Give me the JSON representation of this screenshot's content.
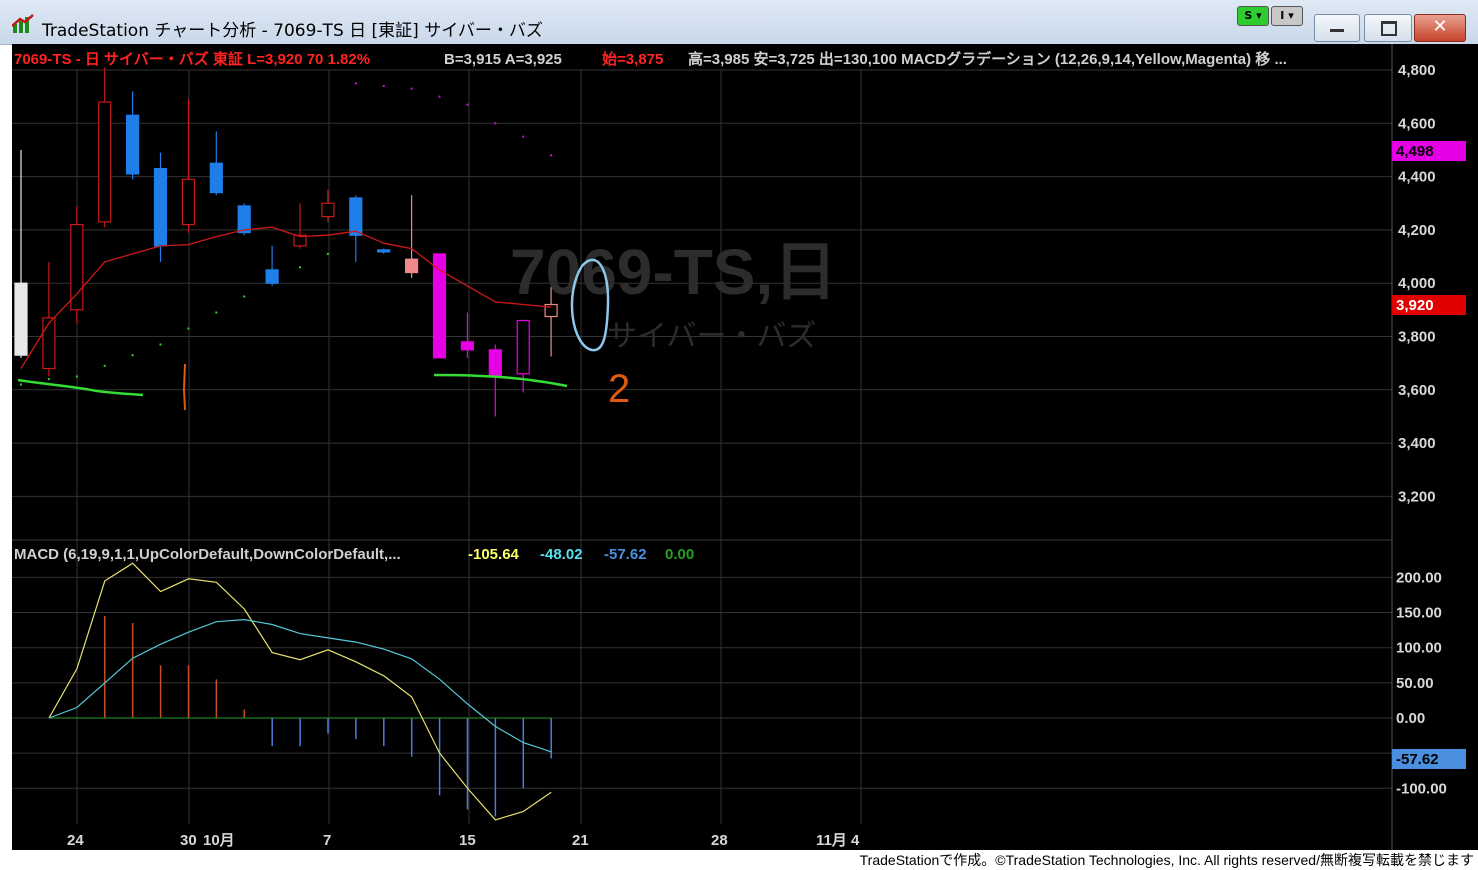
{
  "window": {
    "title": "TradeStation チャート分析 - 7069-TS 日 [東証] サイバー・バズ",
    "mini_buttons": [
      "S",
      "I"
    ],
    "controls": [
      "minimize",
      "maximize",
      "close"
    ]
  },
  "status_line": {
    "symbol_part": "7069-TS - 日  サイバー・バズ  東証  L=3,920  70  1.82%",
    "quote_part": "B=3,915  A=3,925",
    "open_part": "始=3,875",
    "rest_part": "高=3,985  安=3,725  出=130,100  MACDグラデーション (12,26,9,14,Yellow,Magenta)  移 ..."
  },
  "watermark": {
    "symbol": "7069-TS,日",
    "name": "サイバー・バズ"
  },
  "annotation": {
    "number": "2"
  },
  "price_axis": {
    "ticks": [
      "4,800",
      "4,600",
      "4,400",
      "4,200",
      "4,000",
      "3,800",
      "3,600",
      "3,400",
      "3,200"
    ],
    "badge_magenta": "4,498",
    "badge_red": "3,920",
    "colors": {
      "magenta": "#e600e6",
      "red": "#e00000"
    }
  },
  "macd_panel": {
    "label": "MACD (6,19,9,1,1,UpColorDefault,DownColorDefault,...",
    "value_yellow": "-105.64",
    "value_cyan": "-48.02",
    "value_blue": "-57.62",
    "value_green": "0.00",
    "ticks": [
      "200.00",
      "150.00",
      "100.00",
      "50.00",
      "0.00",
      "-100.00"
    ],
    "badge_blue": "-57.62",
    "colors": {
      "yellow": "#ffff66",
      "cyan": "#55e0f0",
      "blue": "#4a8fe0",
      "green": "#22a022"
    }
  },
  "date_axis": {
    "labels": [
      "24",
      "30",
      "10月",
      "7",
      "15",
      "21",
      "28",
      "11月 4"
    ]
  },
  "footer": {
    "text": "TradeStationで作成。©TradeStation Technologies, Inc. All rights reserved/無断複写転載を禁じます"
  },
  "chart_data": {
    "type": "candlestick",
    "price_ylim": [
      3100,
      4850
    ],
    "candles": [
      {
        "o": 3730,
        "h": 4500,
        "l": 3720,
        "c": 4000,
        "color": "white"
      },
      {
        "o": 3680,
        "h": 4080,
        "l": 3650,
        "c": 3870,
        "color": "red"
      },
      {
        "o": 3900,
        "h": 4290,
        "l": 3850,
        "c": 4220,
        "color": "red"
      },
      {
        "o": 4230,
        "h": 4810,
        "l": 4210,
        "c": 4680,
        "color": "red"
      },
      {
        "o": 4630,
        "h": 4720,
        "l": 4390,
        "c": 4410,
        "color": "blue"
      },
      {
        "o": 4430,
        "h": 4490,
        "l": 4080,
        "c": 4140,
        "color": "blue"
      },
      {
        "o": 4220,
        "h": 4690,
        "l": 4190,
        "c": 4390,
        "color": "red"
      },
      {
        "o": 4450,
        "h": 4570,
        "l": 4330,
        "c": 4340,
        "color": "blue"
      },
      {
        "o": 4290,
        "h": 4300,
        "l": 4180,
        "c": 4190,
        "color": "blue"
      },
      {
        "o": 4050,
        "h": 4140,
        "l": 3990,
        "c": 4000,
        "color": "blue"
      },
      {
        "o": 4140,
        "h": 4300,
        "l": 4130,
        "c": 4180,
        "color": "red"
      },
      {
        "o": 4250,
        "h": 4350,
        "l": 4230,
        "c": 4300,
        "color": "red"
      },
      {
        "o": 4320,
        "h": 4330,
        "l": 4080,
        "c": 4180,
        "color": "blue"
      },
      {
        "o": 4125,
        "h": 4130,
        "l": 4110,
        "c": 4120,
        "color": "blue"
      },
      {
        "o": 4040,
        "h": 4330,
        "l": 4020,
        "c": 4090,
        "color": "salmon"
      },
      {
        "o": 4110,
        "h": 4110,
        "l": 3720,
        "c": 3720,
        "color": "magenta"
      },
      {
        "o": 3780,
        "h": 3890,
        "l": 3720,
        "c": 3750,
        "color": "magenta"
      },
      {
        "o": 3750,
        "h": 3770,
        "l": 3500,
        "c": 3650,
        "color": "magenta"
      },
      {
        "o": 3660,
        "h": 3860,
        "l": 3590,
        "c": 3860,
        "color": "magenta_outline"
      },
      {
        "o": 3875,
        "h": 3985,
        "l": 3725,
        "c": 3920,
        "color": "salmon_outline"
      }
    ],
    "moving_average": [
      3680,
      3850,
      3960,
      4080,
      4110,
      4140,
      4145,
      4175,
      4200,
      4210,
      4175,
      4180,
      4195,
      4150,
      4130,
      4050,
      3990,
      3930,
      3920,
      3910
    ],
    "dot_series": [
      3620,
      3640,
      3650,
      3690,
      3730,
      3770,
      3830,
      3890,
      3950,
      4010,
      4060,
      4110,
      4750,
      4740,
      4730,
      4700,
      4670,
      4600,
      4550,
      4480
    ],
    "macd_ylim": [
      -150,
      240
    ],
    "macd_line": [
      0,
      70,
      195,
      220,
      180,
      198,
      193,
      155,
      93,
      83,
      97,
      80,
      60,
      30,
      -50,
      -100,
      -145,
      -133,
      -105.64
    ],
    "signal_line": [
      0,
      15,
      50,
      85,
      105,
      122,
      137,
      140,
      133,
      120,
      114,
      108,
      98,
      84,
      55,
      20,
      -12,
      -35,
      -48.02
    ],
    "histogram": [
      0,
      0,
      145,
      135,
      75,
      75,
      55,
      12,
      -40,
      -40,
      -22,
      -30,
      -40,
      -55,
      -110,
      -130,
      -140,
      -100,
      -57.62
    ],
    "x_labels": [
      "24",
      "30",
      "10月",
      "7",
      "15",
      "21",
      "28",
      "11月 4"
    ]
  }
}
